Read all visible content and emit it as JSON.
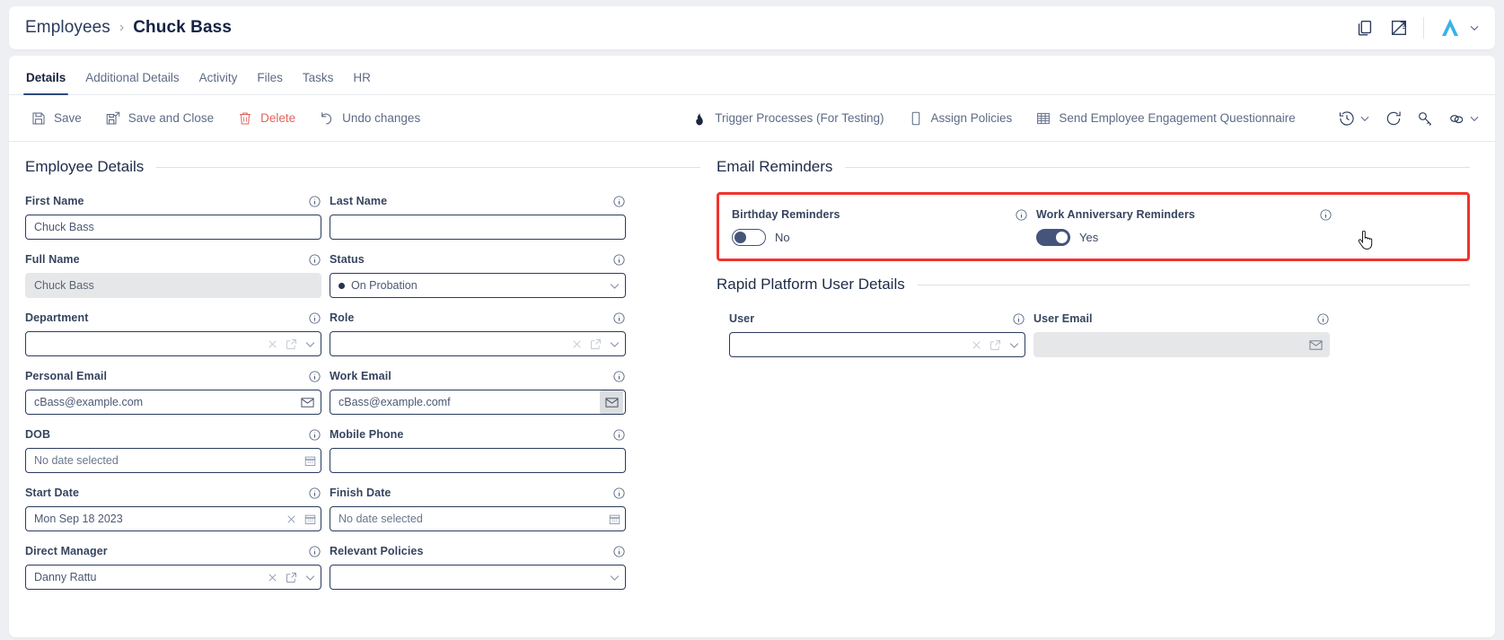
{
  "header": {
    "breadcrumb_parent": "Employees",
    "breadcrumb_sep": "›",
    "breadcrumb_current": "Chuck Bass",
    "icons": [
      "copy-icon",
      "report-icon",
      "brand-logo",
      "chevron-down-icon"
    ]
  },
  "tabs": [
    {
      "label": "Details",
      "active": true
    },
    {
      "label": "Additional Details",
      "active": false
    },
    {
      "label": "Activity",
      "active": false
    },
    {
      "label": "Files",
      "active": false
    },
    {
      "label": "Tasks",
      "active": false
    },
    {
      "label": "HR",
      "active": false
    }
  ],
  "toolbar": {
    "left": [
      {
        "label": "Save",
        "icon": "save-icon",
        "danger": false
      },
      {
        "label": "Save and Close",
        "icon": "save-and-close-icon",
        "danger": false
      },
      {
        "label": "Delete",
        "icon": "trash-icon",
        "danger": true
      },
      {
        "label": "Undo changes",
        "icon": "undo-icon",
        "danger": false
      }
    ],
    "center": [
      {
        "label": "Trigger Processes (For Testing)",
        "icon": "flame-icon"
      },
      {
        "label": "Assign Policies",
        "icon": "document-icon"
      },
      {
        "label": "Send Employee Engagement Questionnaire",
        "icon": "grid-icon"
      }
    ],
    "right": [
      {
        "icon": "history-icon",
        "has_chevron": true
      },
      {
        "icon": "refresh-icon",
        "has_chevron": false
      },
      {
        "icon": "key-icon",
        "has_chevron": false
      },
      {
        "icon": "link-icon",
        "has_chevron": true
      }
    ]
  },
  "employee_details": {
    "section_title": "Employee Details",
    "fields": [
      {
        "label": "First Name",
        "value": "Chuck Bass",
        "type": "text",
        "readonly": false
      },
      {
        "label": "Last Name",
        "value": "",
        "type": "text",
        "readonly": false
      },
      {
        "label": "Full Name",
        "value": "Chuck Bass",
        "type": "text",
        "readonly": true
      },
      {
        "label": "Status",
        "value": "On Probation",
        "type": "select-dot",
        "readonly": false
      },
      {
        "label": "Department",
        "value": "",
        "type": "lookup",
        "readonly": false
      },
      {
        "label": "Role",
        "value": "",
        "type": "lookup",
        "readonly": false
      },
      {
        "label": "Personal Email",
        "value": "cBass@example.com",
        "type": "email-btn",
        "readonly": false
      },
      {
        "label": "Work Email",
        "value": "cBass@example.comf",
        "type": "email-btn",
        "readonly": false
      },
      {
        "label": "DOB",
        "value": "No date selected",
        "type": "date",
        "readonly": false
      },
      {
        "label": "Mobile Phone",
        "value": "",
        "type": "text",
        "readonly": false
      },
      {
        "label": "Start Date",
        "value": "Mon Sep 18 2023",
        "type": "date-clear",
        "readonly": false
      },
      {
        "label": "Finish Date",
        "value": "No date selected",
        "type": "date",
        "readonly": false
      },
      {
        "label": "Direct Manager",
        "value": "Danny Rattu",
        "type": "lookup-filled",
        "readonly": false
      },
      {
        "label": "Relevant Policies",
        "value": "",
        "type": "select",
        "readonly": false
      }
    ]
  },
  "email_reminders": {
    "section_title": "Email Reminders",
    "highlighted": true,
    "highlight_color": "#f0342c",
    "toggles": [
      {
        "label": "Birthday Reminders",
        "state_label": "No",
        "on": false
      },
      {
        "label": "Work Anniversary Reminders",
        "state_label": "Yes",
        "on": true
      }
    ]
  },
  "rapid_platform": {
    "section_title": "Rapid Platform User Details",
    "fields": [
      {
        "label": "User",
        "value": "",
        "type": "lookup",
        "readonly": false
      },
      {
        "label": "User Email",
        "value": "",
        "type": "email-readonly",
        "readonly": true
      }
    ]
  },
  "colors": {
    "accent": "#2b4a7e",
    "danger": "#e0645c",
    "highlight": "#f0342c",
    "toggle_on": "#45547a",
    "brand": "#36b3e8",
    "page_bg": "#edeff2"
  }
}
